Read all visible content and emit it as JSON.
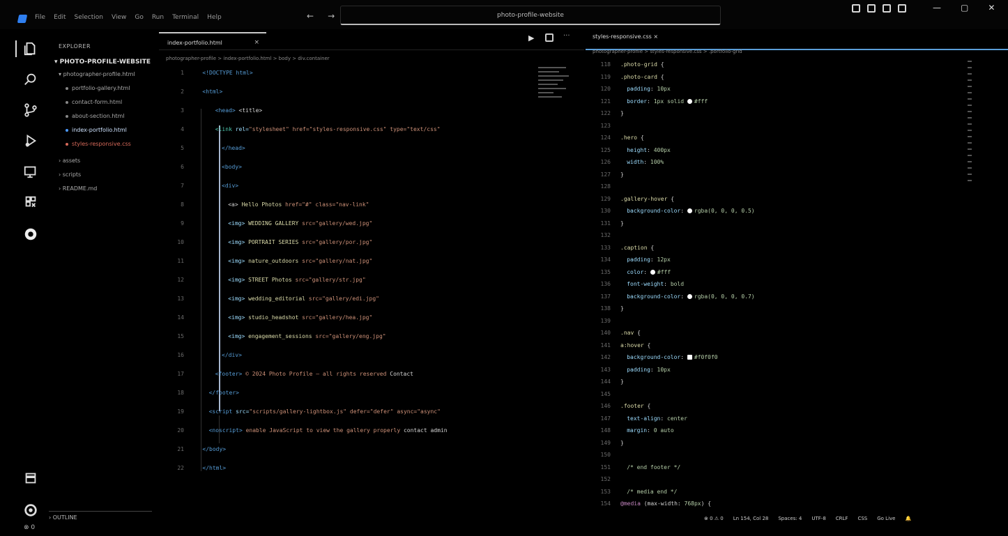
{
  "menu": {
    "items": [
      "File",
      "Edit",
      "Selection",
      "View",
      "Go",
      "Run",
      "Terminal",
      "Help"
    ],
    "nav_back": "←",
    "nav_forward": "→"
  },
  "search": {
    "text": "photo-profile-website"
  },
  "window": {
    "minimize": "—",
    "maximize": "▢",
    "close": "✕"
  },
  "activity": {
    "icons": [
      "explorer-icon",
      "search-icon",
      "source-control-icon",
      "run-debug-icon",
      "extensions-icon",
      "remote-icon",
      "copilot-icon",
      "accounts-icon",
      "settings-icon"
    ]
  },
  "sidebar": {
    "title": "EXPLORER",
    "folder": "PHOTO-PROFILE-WEBSITE",
    "items": [
      {
        "label": "photographer-profile.html",
        "kind": "folder"
      },
      {
        "label": "portfolio-gallery.html",
        "kind": "file"
      },
      {
        "label": "contact-form.html",
        "kind": "file"
      },
      {
        "label": "about-section.html",
        "kind": "file"
      },
      {
        "label": "index-portfolio.html",
        "kind": "file",
        "active": true
      },
      {
        "label": "styles-responsive.css",
        "kind": "file",
        "error": true
      },
      {
        "label": "assets",
        "kind": "folder"
      },
      {
        "label": "scripts",
        "kind": "folder"
      },
      {
        "label": "README.md",
        "kind": "folder"
      }
    ],
    "outline": "OUTLINE",
    "timeline_count": "⊗ 0"
  },
  "tabs": {
    "left_active": "index-portfolio.html",
    "right_active": "styles-responsive.css",
    "close": "×",
    "run": "▶",
    "more": "···"
  },
  "breadcrumb": {
    "left": "photographer-profile > index-portfolio.html > body > div.container",
    "right": "photographer-profile > styles-responsive.css > .portfolio-grid"
  },
  "left_code": [
    {
      "n": "1",
      "tokens": [
        [
          "kw",
          "<!DOCTYPE html>"
        ]
      ],
      "indent": 4
    },
    {
      "n": "2",
      "tokens": [
        [
          "kw",
          "<html>"
        ]
      ],
      "indent": 4
    },
    {
      "n": "3",
      "tokens": [
        [
          "kw",
          "<head>"
        ],
        [
          "tx",
          " <title>"
        ]
      ],
      "indent": 8
    },
    {
      "n": "4",
      "tokens": [
        [
          "tag",
          "<link"
        ],
        [
          "at",
          " rel="
        ],
        [
          "st",
          "\"stylesheet\" href=\"styles-responsive.css\" type=\"text/css\""
        ]
      ],
      "indent": 8
    },
    {
      "n": "5",
      "tokens": [
        [
          "kw",
          "</head>"
        ]
      ],
      "indent": 10
    },
    {
      "n": "6",
      "tokens": [
        [
          "kw",
          "<body>"
        ]
      ],
      "indent": 10
    },
    {
      "n": "7",
      "tokens": [
        [
          "kw",
          "<div>"
        ]
      ],
      "indent": 10
    },
    {
      "n": "8",
      "tokens": [
        [
          "tx",
          "  <a>"
        ],
        [
          "yl",
          " Hello Photos"
        ],
        [
          "st",
          "  href=\"#\"  class=\"nav-link\" "
        ]
      ],
      "indent": 12
    },
    {
      "n": "9",
      "tokens": [
        [
          "tx",
          "  "
        ],
        [
          "at",
          "<img>"
        ],
        [
          "yl",
          " WEDDING GALLERY"
        ],
        [
          "st",
          "  src=\"gallery/wed.jpg\""
        ]
      ],
      "indent": 12
    },
    {
      "n": "10",
      "tokens": [
        [
          "tx",
          "  "
        ],
        [
          "at",
          "<img>"
        ],
        [
          "yl",
          " PORTRAIT SERIES"
        ],
        [
          "st",
          "  src=\"gallery/por.jpg\""
        ]
      ],
      "indent": 12
    },
    {
      "n": "11",
      "tokens": [
        [
          "tx",
          "  "
        ],
        [
          "at",
          "<img>"
        ],
        [
          "yl",
          " nature_outdoors"
        ],
        [
          "st",
          "  src=\"gallery/nat.jpg\""
        ]
      ],
      "indent": 12
    },
    {
      "n": "12",
      "tokens": [
        [
          "tx",
          "  "
        ],
        [
          "at",
          "<img>"
        ],
        [
          "yl",
          " STREET Photos"
        ],
        [
          "st",
          "  src=\"gallery/str.jpg\""
        ]
      ],
      "indent": 12
    },
    {
      "n": "13",
      "tokens": [
        [
          "tx",
          "  "
        ],
        [
          "at",
          "<img>"
        ],
        [
          "yl",
          " wedding_editorial"
        ],
        [
          "st",
          "  src=\"gallery/edi.jpg\""
        ]
      ],
      "indent": 12
    },
    {
      "n": "14",
      "tokens": [
        [
          "tx",
          "  "
        ],
        [
          "at",
          "<img>"
        ],
        [
          "yl",
          " studio_headshot"
        ],
        [
          "st",
          "  src=\"gallery/hea.jpg\""
        ]
      ],
      "indent": 12
    },
    {
      "n": "15",
      "tokens": [
        [
          "tx",
          "  "
        ],
        [
          "at",
          "<img>"
        ],
        [
          "yl",
          " engagement_sessions"
        ],
        [
          "st",
          "  src=\"gallery/eng.jpg\""
        ]
      ],
      "indent": 12
    },
    {
      "n": "16",
      "tokens": [
        [
          "kw",
          "</div>"
        ]
      ],
      "indent": 10
    },
    {
      "n": "17",
      "tokens": [
        [
          "kw",
          "<footer>"
        ],
        [
          "st",
          "  © 2024 Photo Profile — all rights reserved  "
        ],
        [
          "tx",
          "   Contact"
        ]
      ],
      "indent": 8
    },
    {
      "n": "18",
      "tokens": [
        [
          "kw",
          "</footer>"
        ]
      ],
      "indent": 6
    },
    {
      "n": "19",
      "tokens": [
        [
          "kw",
          "<script"
        ],
        [
          "at",
          " src="
        ],
        [
          "st",
          "\"scripts/gallery-lightbox.js\" defer=\"defer\" async=\"async\""
        ]
      ],
      "indent": 6
    },
    {
      "n": "20",
      "tokens": [
        [
          "kw",
          "<noscript>"
        ],
        [
          "st",
          " enable JavaScript to view the gallery properly"
        ],
        [
          "tx",
          "   contact admin"
        ]
      ],
      "indent": 6
    },
    {
      "n": "21",
      "tokens": [
        [
          "kw",
          "</body>"
        ]
      ],
      "indent": 4
    },
    {
      "n": "22",
      "tokens": [
        [
          "kw",
          "</html>"
        ]
      ],
      "indent": 4
    }
  ],
  "right_code": [
    {
      "n": "118",
      "tokens": [
        [
          "yl",
          ".photo-grid"
        ],
        [
          "tx",
          " {"
        ]
      ]
    },
    {
      "n": "119",
      "tokens": [
        [
          "yl",
          ".photo-card"
        ],
        [
          "tx",
          " {"
        ]
      ]
    },
    {
      "n": "120",
      "tokens": [
        [
          "at",
          "padding"
        ],
        [
          "tx",
          ": "
        ],
        [
          "nm",
          "10px"
        ]
      ],
      "indent": 2
    },
    {
      "n": "121",
      "tokens": [
        [
          "at",
          "border"
        ],
        [
          "tx",
          ": "
        ],
        [
          "nm",
          "1px solid "
        ],
        [
          "sw",
          ""
        ],
        [
          "nm",
          "#fff"
        ]
      ],
      "indent": 2
    },
    {
      "n": "122",
      "tokens": [
        [
          "tx",
          "}"
        ]
      ]
    },
    {
      "n": "123",
      "tokens": []
    },
    {
      "n": "124",
      "tokens": [
        [
          "yl",
          ".hero"
        ],
        [
          "tx",
          " {"
        ]
      ]
    },
    {
      "n": "125",
      "tokens": [
        [
          "at",
          "height"
        ],
        [
          "tx",
          ": "
        ],
        [
          "nm",
          "400px"
        ]
      ],
      "indent": 2
    },
    {
      "n": "126",
      "tokens": [
        [
          "at",
          "width"
        ],
        [
          "tx",
          ": "
        ],
        [
          "nm",
          "100%"
        ]
      ],
      "indent": 2
    },
    {
      "n": "127",
      "tokens": [
        [
          "tx",
          "}"
        ]
      ]
    },
    {
      "n": "128",
      "tokens": []
    },
    {
      "n": "129",
      "tokens": [
        [
          "yl",
          ".gallery-hover"
        ],
        [
          "tx",
          " {"
        ]
      ]
    },
    {
      "n": "130",
      "tokens": [
        [
          "at",
          "background-color"
        ],
        [
          "tx",
          ": "
        ],
        [
          "sw",
          ""
        ],
        [
          "nm",
          "rgba(0, 0, 0, 0.5)"
        ]
      ],
      "indent": 2
    },
    {
      "n": "131",
      "tokens": [
        [
          "tx",
          "}"
        ]
      ]
    },
    {
      "n": "132",
      "tokens": []
    },
    {
      "n": "133",
      "tokens": [
        [
          "yl",
          ".caption"
        ],
        [
          "tx",
          " {"
        ]
      ]
    },
    {
      "n": "134",
      "tokens": [
        [
          "at",
          "padding"
        ],
        [
          "tx",
          ": "
        ],
        [
          "nm",
          "12px"
        ]
      ],
      "indent": 2
    },
    {
      "n": "135",
      "tokens": [
        [
          "at",
          "color"
        ],
        [
          "tx",
          ": "
        ],
        [
          "sw",
          ""
        ],
        [
          "nm",
          "#fff"
        ]
      ],
      "indent": 2
    },
    {
      "n": "136",
      "tokens": [
        [
          "at",
          "font-weight"
        ],
        [
          "tx",
          ": "
        ],
        [
          "nm",
          "bold"
        ]
      ],
      "indent": 2
    },
    {
      "n": "137",
      "tokens": [
        [
          "at",
          "background-color"
        ],
        [
          "tx",
          ": "
        ],
        [
          "sw",
          ""
        ],
        [
          "nm",
          "rgba(0, 0, 0, 0.7)"
        ]
      ],
      "indent": 2
    },
    {
      "n": "138",
      "tokens": [
        [
          "tx",
          "}"
        ]
      ]
    },
    {
      "n": "139",
      "tokens": []
    },
    {
      "n": "140",
      "tokens": [
        [
          "yl",
          ".nav"
        ],
        [
          "tx",
          " {"
        ]
      ]
    },
    {
      "n": "141",
      "tokens": [
        [
          "yl",
          "a:hover"
        ],
        [
          "tx",
          " {"
        ]
      ]
    },
    {
      "n": "142",
      "tokens": [
        [
          "at",
          "background-color"
        ],
        [
          "tx",
          ": "
        ],
        [
          "sb",
          ""
        ],
        [
          "nm",
          "#f0f0f0"
        ]
      ],
      "indent": 2
    },
    {
      "n": "143",
      "tokens": [
        [
          "at",
          "padding"
        ],
        [
          "tx",
          ": "
        ],
        [
          "nm",
          "10px"
        ]
      ],
      "indent": 2
    },
    {
      "n": "144",
      "tokens": [
        [
          "tx",
          "}"
        ]
      ]
    },
    {
      "n": "145",
      "tokens": []
    },
    {
      "n": "146",
      "tokens": [
        [
          "yl",
          ".footer"
        ],
        [
          "tx",
          " {"
        ]
      ]
    },
    {
      "n": "147",
      "tokens": [
        [
          "at",
          "text-align"
        ],
        [
          "tx",
          ": "
        ],
        [
          "nm",
          "center"
        ]
      ],
      "indent": 2
    },
    {
      "n": "148",
      "tokens": [
        [
          "at",
          "margin"
        ],
        [
          "tx",
          ": "
        ],
        [
          "nm",
          "0 auto"
        ]
      ],
      "indent": 2
    },
    {
      "n": "149",
      "tokens": [
        [
          "tx",
          "}"
        ]
      ]
    },
    {
      "n": "150",
      "tokens": []
    },
    {
      "n": "151",
      "tokens": [
        [
          "tx",
          "  "
        ],
        [
          "nm",
          "/* end footer */"
        ]
      ],
      "indent": 2
    },
    {
      "n": "152",
      "tokens": []
    },
    {
      "n": "153",
      "tokens": [
        [
          "tx",
          "  "
        ],
        [
          "nm",
          "/* media end */"
        ]
      ],
      "indent": 2
    },
    {
      "n": "154",
      "tokens": [
        [
          "pr",
          "@media"
        ],
        [
          "tx",
          " (max-width: "
        ],
        [
          "nm",
          "768px"
        ],
        [
          "tx",
          ") {"
        ]
      ]
    }
  ],
  "statusbar": {
    "items": [
      "⊗ 0 ⚠ 0",
      "Ln 154, Col 28",
      "Spaces: 4",
      "UTF-8",
      "CRLF",
      "CSS",
      "Go Live",
      "🔔"
    ]
  }
}
